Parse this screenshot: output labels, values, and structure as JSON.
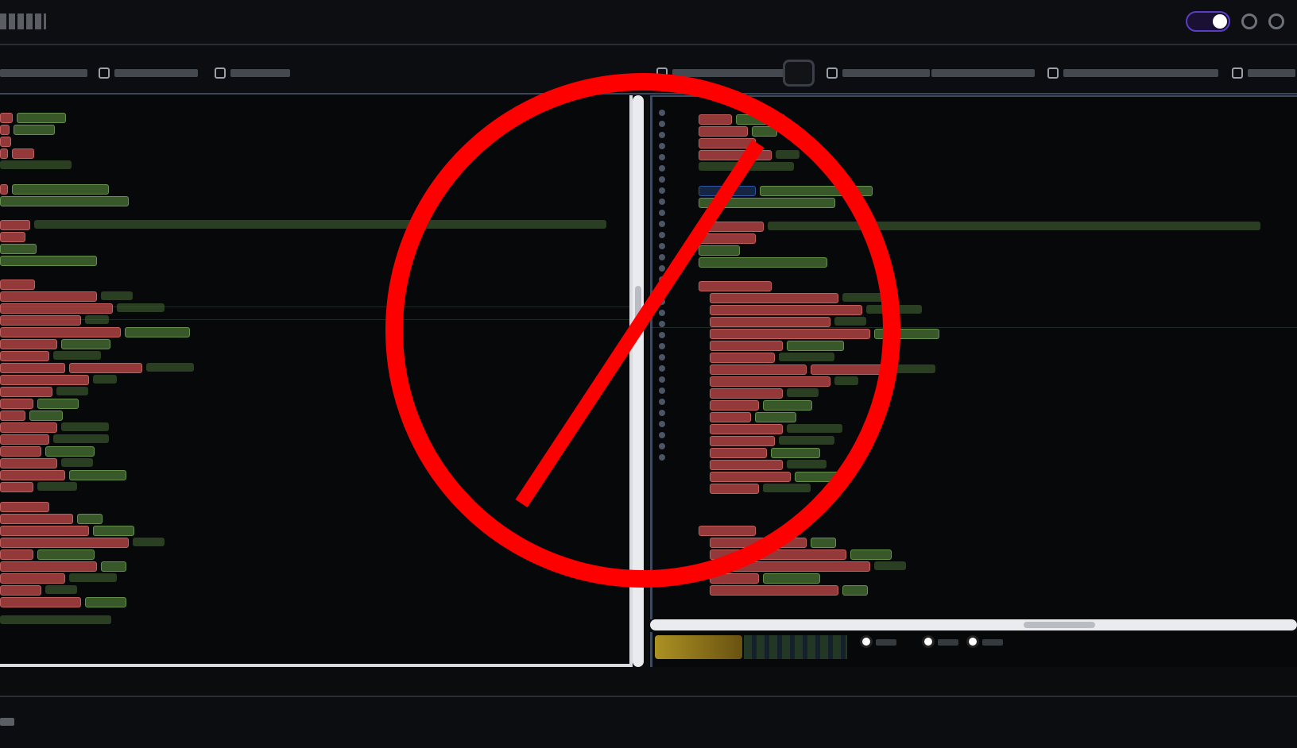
{
  "window": {
    "title": "",
    "theme_toggle": "on"
  },
  "toolbar": {
    "items": [
      "",
      "",
      "",
      "",
      "",
      "",
      "",
      "",
      ""
    ]
  },
  "editor": {
    "left_pane": {
      "label": ""
    },
    "right_pane": {
      "label": ""
    }
  },
  "overlay": {
    "symbol": "prohibition-sign-icon",
    "color": "#ff0000"
  },
  "footer": {
    "status": ""
  },
  "colors": {
    "accent": "#5b3cc4",
    "deleted": "#c24a4a",
    "added": "#8dc86b",
    "selection": "#3a6fd8"
  }
}
